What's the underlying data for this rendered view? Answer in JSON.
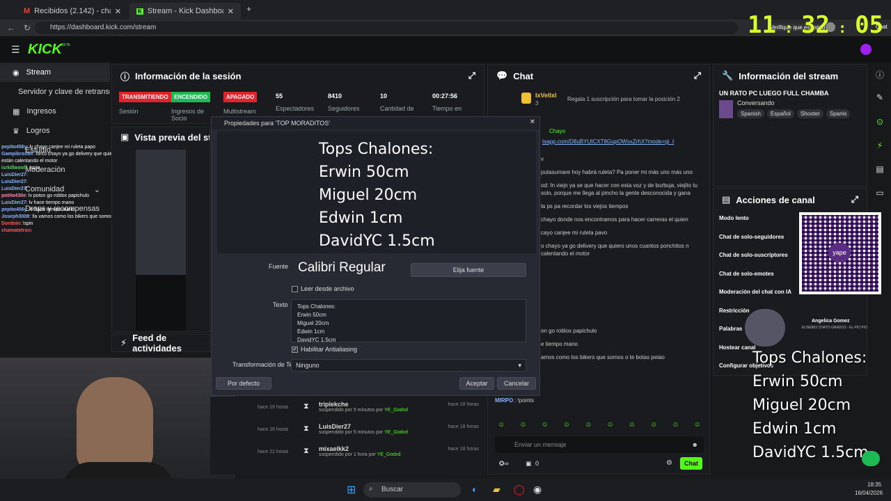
{
  "browser": {
    "tabs": [
      {
        "label": "Recibidos (2.142) - chayo.tube.18@"
      },
      {
        "label": "Stream - Kick Dashboard"
      }
    ],
    "url": "https://dashboard.kick.com/stream",
    "verify_label": "Verifique que es usted",
    "chat_label": "Chat"
  },
  "clock": {
    "hh": "11",
    "mm": "32",
    "ss": "05"
  },
  "kick": {
    "logo": "KICK",
    "beta": "BETA"
  },
  "sidebar": {
    "items": [
      {
        "label": "Stream"
      },
      {
        "label": "Servidor y clave de retransmisión"
      },
      {
        "label": "Ingresos"
      },
      {
        "label": "Logros"
      },
      {
        "label": "Estudio"
      },
      {
        "label": "Moderación"
      },
      {
        "label": "Comunidad"
      },
      {
        "label": "Drops y recompensas"
      }
    ]
  },
  "session": {
    "title": "Información de la sesión",
    "stats": [
      {
        "badge": "TRANSMITIENDO",
        "badge_color": "#e5212a",
        "label": "Sesión"
      },
      {
        "badge": "ENCENDIDO",
        "badge_color": "#1db954",
        "label": "Ingresos de Socio"
      },
      {
        "badge": "APAGADO",
        "badge_color": "#e5212a",
        "label": "Multistream"
      },
      {
        "value": "55",
        "label": "Espectadores"
      },
      {
        "value": "8410",
        "label": "Seguidores"
      },
      {
        "value": "10",
        "label": "Cantidad de"
      },
      {
        "value": "00:27:56",
        "label": "Tiempo en"
      }
    ]
  },
  "preview_panel": {
    "title": "Vista previa del stream"
  },
  "feed": {
    "title": "Feed de actividades",
    "default_label": "Por defecto"
  },
  "left_chat": [
    {
      "user": "pepito456y",
      "text": ": lv chayo canjee mi ruleta papo",
      "color": "#8ab4ff"
    },
    {
      "user": "Gampibroster",
      "text": ": lorco chayo ya go delivery que quiero unos cuantos ponchitos por que ya me están calentando el motor",
      "color": "#8ab4ff"
    },
    {
      "user": "isrkillwoolf",
      "text": ": !spin",
      "color": "#5bd36b"
    },
    {
      "user": "LuisDier27",
      "text": ":",
      "color": "#8ab4ff"
    },
    {
      "user": "LuisDier27",
      "text": ":",
      "color": "#8ab4ff"
    },
    {
      "user": "LuisDier27",
      "text": ":",
      "color": "#8ab4ff"
    },
    {
      "user": "potito430e",
      "text": ": lv poton go roblox papichulo",
      "color": "#ff8ab4"
    },
    {
      "user": "LuisDier27",
      "text": ": lv hace tiempo mano",
      "color": "#8ab4ff"
    },
    {
      "user": "pepito456y",
      "text": ": lv hace tiempo mano",
      "color": "#8ab4ff"
    },
    {
      "user": "Joseph3008",
      "text": ": !la vamos como los bikers que somos o te botas pelao",
      "color": "#8ab4ff"
    },
    {
      "user": "Dordoin",
      "text": ": !spin",
      "color": "#ff5a5a"
    },
    {
      "user": "chamatetron",
      "text": ":",
      "color": "#ff5a5a"
    }
  ],
  "chat": {
    "title": "Chat",
    "top_user": "IxVellxl",
    "top_count": "3",
    "gift_text": "Regala 1 suscripción para tomar la posición 2",
    "pinned_user": "Chayo",
    "pinned_link": "tsapp.com/D8uBYUtCXT8GupOWsxZrhX?mode=gi_t",
    "messages": [
      "v",
      "putasumare hoy habrá ruleta? Pa poner mi más uno más uno",
      "od: In viejo ya se que hacer con esta voz y de burbuja, viejito tu solo, porque me llega al pincho la gente desconocida y gana",
      "la ps pa recordar los viejos tiempos",
      "chayo donde nos encontramos para hacer carreras el quien",
      "cayo canjee mi ruleta pavo",
      "o chayo ya go delivery que quiero unos cuantos ponchitos n calentando el motor",
      "on go roblox papichulo",
      "e tiempo mano",
      "amos como los bikers que somos o te botas pelao"
    ],
    "last_user": "MIRPO",
    "last_text": ": !points",
    "input_placeholder": "Enviar un mensaje",
    "points": "0",
    "send_label": "Chat"
  },
  "stream_info": {
    "title": "Información del stream",
    "stream_title": "UN RATO PC LUEGO FULL CHAMBA",
    "category": "Conversando",
    "tags": [
      "Spanish",
      "Español",
      "Shooter",
      "Spanis"
    ]
  },
  "channel_actions": {
    "title": "Acciones de canal",
    "items": [
      "Modo lento",
      "Chat de solo-seguidores",
      "Chat de solo-suscriptores",
      "Chat de solo-emotes",
      "Moderación del chat con IA",
      "Restricción",
      "Palabras",
      "Hostear canal",
      "Configurar objetivos"
    ]
  },
  "donor": {
    "name": "Angelica Gomez",
    "subtitle": "EUSEBIO CHATO GRADOS - EL PIO PIO"
  },
  "qr": {
    "label": "yape"
  },
  "overlay_text": [
    "Tops Chalones:",
    "Erwin 50cm",
    "Miguel 20cm",
    "Edwin 1cm",
    "DavidYC 1.5cm"
  ],
  "activity": [
    {
      "user": "triplekche",
      "detail": "suspendido por 5 minutos por",
      "by": "YE_Godxd",
      "time": "hace 18 horas"
    },
    {
      "user": "LuisDier27",
      "detail": "suspendido por 5 minutos por",
      "by": "YE_Godxd",
      "time": "hace 18 horas"
    },
    {
      "user": "mixaelkk2",
      "detail": "suspendido por 1 hora por",
      "by": "YE_Godxd",
      "time": "hace 18 horas"
    }
  ],
  "activity_left_times": [
    "hace 18 horas",
    "hace 18 horas",
    "hace 21 horas"
  ],
  "dialog": {
    "title": "Propiedades para 'TOP MORADITOS'",
    "preview_lines": [
      "Tops Chalones:",
      "Erwin 50cm",
      "Miguel 20cm",
      "Edwin 1cm",
      "DavidYC 1.5cm"
    ],
    "font_label": "Fuente",
    "font_value": "Calibri Regular",
    "font_button": "Elija fuente",
    "read_file_label": "Leer desde archivo",
    "text_label": "Texto",
    "text_lines": [
      "Tops Chalones:",
      "Erwin 50cm",
      "Miguel 20cm",
      "Edwin 1cm",
      "DavidYC 1.5cm"
    ],
    "antialias_label": "Habilitar Antialiasing",
    "transform_label": "Transformación de Texto",
    "transform_value": "Ninguno",
    "accept": "Aceptar",
    "cancel": "Cancelar"
  },
  "taskbar": {
    "search": "Buscar",
    "time": "18:35",
    "date": "16/04/2026"
  }
}
